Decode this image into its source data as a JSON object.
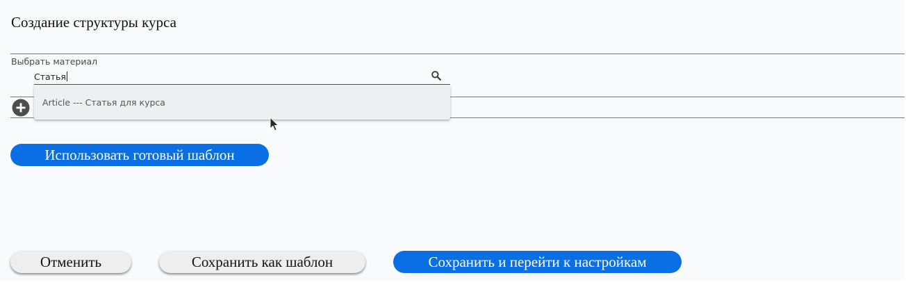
{
  "page": {
    "title": "Создание структуры курса"
  },
  "material_field": {
    "label": "Выбрать материал",
    "value": "Статья",
    "search_icon": "search-icon",
    "dropdown_options": [
      {
        "label": "Article --- Статья для курса"
      }
    ]
  },
  "structure": {
    "add_icon": "plus-circle-icon"
  },
  "template_button": {
    "label": "Использовать готовый шаблон"
  },
  "footer": {
    "cancel_label": "Отменить",
    "save_template_label": "Сохранить как шаблон",
    "save_continue_label": "Сохранить и перейти к настройкам"
  },
  "colors": {
    "primary": "#0a6ee4",
    "secondary_button": "#eeeeee",
    "panel_background": "#f9fafc",
    "dropdown_background": "#eeeff0",
    "add_icon": "#4d4d4d"
  }
}
